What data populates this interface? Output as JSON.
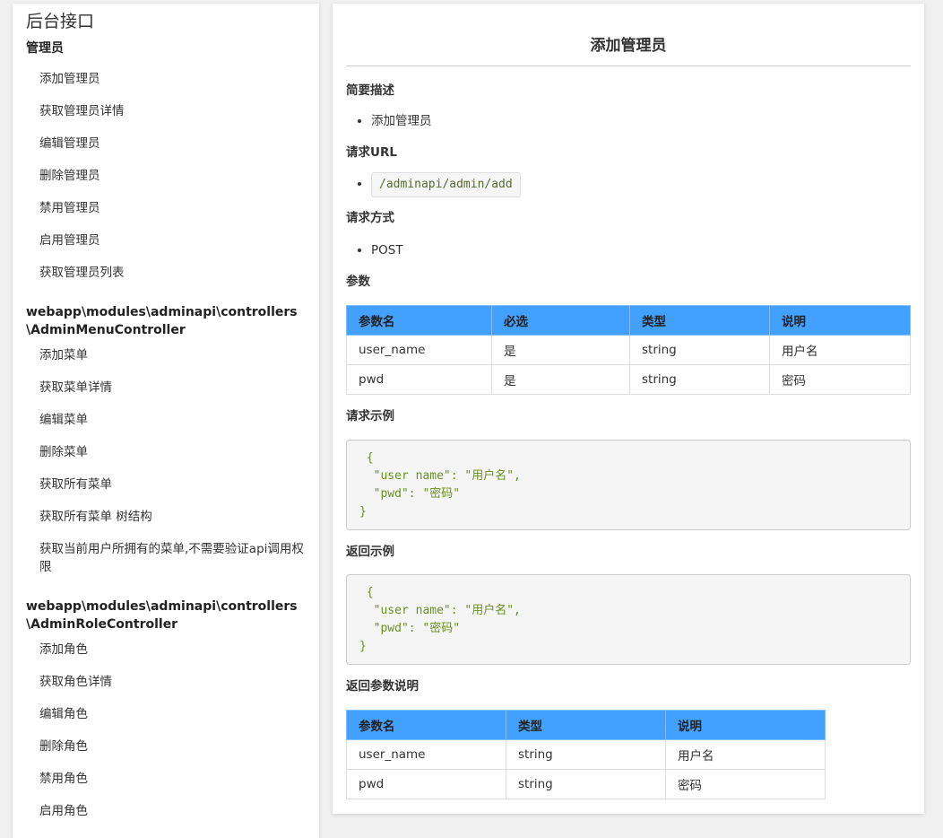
{
  "sidebar": {
    "title": "后台接口",
    "groups": [
      {
        "title": "管理员",
        "items": [
          "添加管理员",
          "获取管理员详情",
          "编辑管理员",
          "删除管理员",
          "禁用管理员",
          "启用管理员",
          "获取管理员列表"
        ]
      },
      {
        "title": "webapp\\modules\\adminapi\\controllers\\AdminMenuController",
        "items": [
          "添加菜单",
          "获取菜单详情",
          "编辑菜单",
          "删除菜单",
          "获取所有菜单",
          "获取所有菜单 树结构",
          "获取当前用户所拥有的菜单,不需要验证api调用权限"
        ]
      },
      {
        "title": "webapp\\modules\\adminapi\\controllers\\AdminRoleController",
        "items": [
          "添加角色",
          "获取角色详情",
          "编辑角色",
          "删除角色",
          "禁用角色",
          "启用角色"
        ]
      }
    ]
  },
  "main": {
    "title": "添加管理员",
    "brief_label": "简要描述",
    "brief": "添加管理员",
    "url_label": "请求URL",
    "url": "/adminapi/admin/add",
    "method_label": "请求方式",
    "method": "POST",
    "params_label": "参数",
    "params_headers": [
      "参数名",
      "必选",
      "类型",
      "说明"
    ],
    "params_rows": [
      [
        "user_name",
        "是",
        "string",
        "用户名"
      ],
      [
        "pwd",
        "是",
        "string",
        "密码"
      ]
    ],
    "request_example_label": "请求示例",
    "request_example": " {\n  \"user name\": \"用户名\",\n  \"pwd\": \"密码\"\n}",
    "response_example_label": "返回示例",
    "response_example": " {\n  \"user name\": \"用户名\",\n  \"pwd\": \"密码\"\n}",
    "response_params_label": "返回参数说明",
    "response_headers": [
      "参数名",
      "类型",
      "说明"
    ],
    "response_rows": [
      [
        "user_name",
        "string",
        "用户名"
      ],
      [
        "pwd",
        "string",
        "密码"
      ]
    ]
  },
  "colors": {
    "table_header": "#42a0ff",
    "code_text": "#6b8e23"
  }
}
